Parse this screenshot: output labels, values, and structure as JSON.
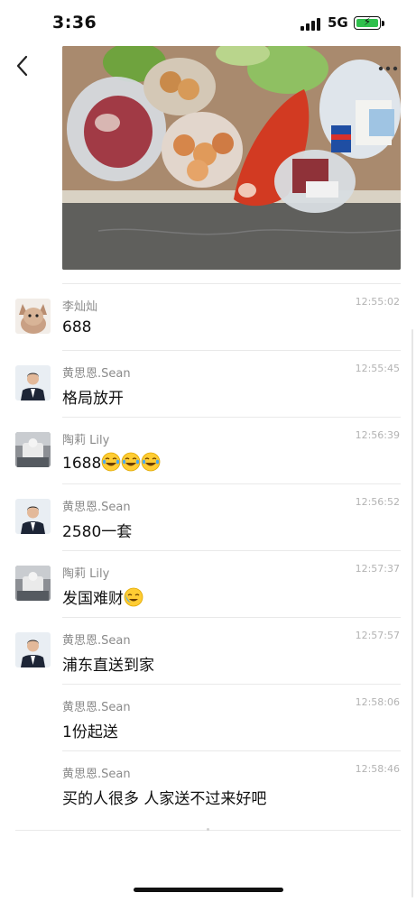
{
  "status_bar": {
    "time": "3:36",
    "network": "5G",
    "battery_charging": true
  },
  "header": {
    "back_icon": "chevron-left-icon",
    "more_icon": "more-dots-icon"
  },
  "photo": {
    "description_icon": "grocery-photo"
  },
  "messages": [
    {
      "sender": "李灿灿",
      "time": "12:55:02",
      "text": "688",
      "avatar": "cat-avatar",
      "show_avatar": true,
      "emojis": 0
    },
    {
      "sender": "黄思恩.Sean",
      "time": "12:55:45",
      "text": "格局放开",
      "avatar": "suit-avatar",
      "show_avatar": true,
      "emojis": 0
    },
    {
      "sender": "陶莉 Lily",
      "time": "12:56:39",
      "text": "1688",
      "avatar": "car-avatar",
      "show_avatar": true,
      "emojis": 3
    },
    {
      "sender": "黄思恩.Sean",
      "time": "12:56:52",
      "text": "2580一套",
      "avatar": "suit-avatar",
      "show_avatar": true,
      "emojis": 0
    },
    {
      "sender": "陶莉 Lily",
      "time": "12:57:37",
      "text": "发国难财",
      "avatar": "car-avatar",
      "show_avatar": true,
      "emojis": 1
    },
    {
      "sender": "黄思恩.Sean",
      "time": "12:57:57",
      "text": "浦东直送到家",
      "avatar": "suit-avatar",
      "show_avatar": true,
      "emojis": 0
    },
    {
      "sender": "黄思恩.Sean",
      "time": "12:58:06",
      "text": "1份起送",
      "avatar": "suit-avatar",
      "show_avatar": false,
      "emojis": 0
    },
    {
      "sender": "黄思恩.Sean",
      "time": "12:58:46",
      "text": "买的人很多 人家送不过来好吧",
      "avatar": "suit-avatar",
      "show_avatar": false,
      "emojis": 0
    }
  ],
  "colors": {
    "name": "#8a8a8a",
    "time": "#b3b3b3",
    "separator": "#e9e9e9",
    "battery": "#2fbf4c"
  }
}
